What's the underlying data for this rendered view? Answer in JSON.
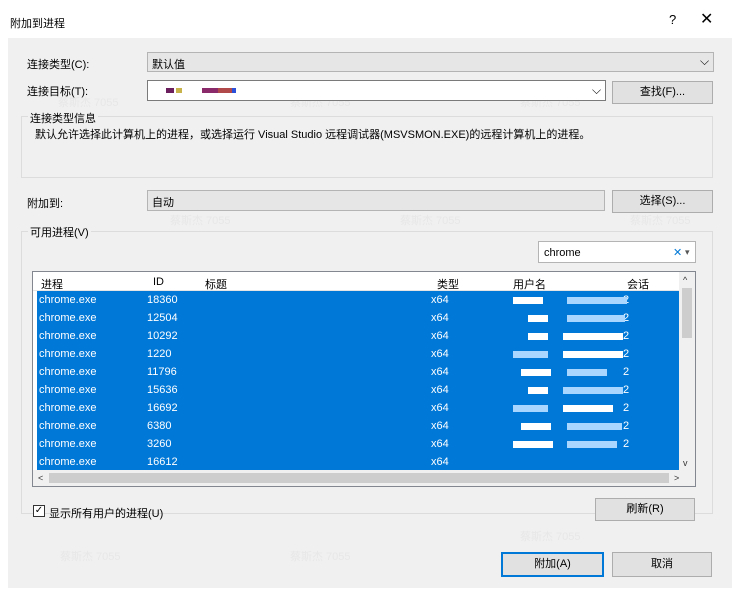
{
  "window": {
    "title": "附加到进程",
    "help_glyph": "?",
    "close_glyph": "✕"
  },
  "connection_type": {
    "label": "连接类型(C):",
    "value": "默认值",
    "arrow": "⌵"
  },
  "connection_target": {
    "label": "连接目标(T):",
    "arrow": "⌵",
    "find_button": "查找(F)..."
  },
  "info_group": {
    "title": "连接类型信息",
    "text": "默认允许选择此计算机上的进程，或选择运行 Visual Studio 远程调试器(MSVSMON.EXE)的远程计算机上的进程。"
  },
  "attach_to": {
    "label": "附加到:",
    "value": "自动",
    "select_button": "选择(S)..."
  },
  "process_group": {
    "title": "可用进程(V)"
  },
  "filter": {
    "value": "chrome",
    "clear_glyph": "✕",
    "dropdown_glyph": "▾"
  },
  "table": {
    "columns": [
      "进程",
      "ID",
      "标题",
      "类型",
      "用户名",
      "会话"
    ],
    "rows": [
      {
        "process": "chrome.exe",
        "id": "18360",
        "type": "x64",
        "session": "2"
      },
      {
        "process": "chrome.exe",
        "id": "12504",
        "type": "x64",
        "session": "2"
      },
      {
        "process": "chrome.exe",
        "id": "10292",
        "type": "x64",
        "session": "2"
      },
      {
        "process": "chrome.exe",
        "id": "1220",
        "type": "x64",
        "session": "2"
      },
      {
        "process": "chrome.exe",
        "id": "11796",
        "type": "x64",
        "session": "2"
      },
      {
        "process": "chrome.exe",
        "id": "15636",
        "type": "x64",
        "session": "2"
      },
      {
        "process": "chrome.exe",
        "id": "16692",
        "type": "x64",
        "session": "2"
      },
      {
        "process": "chrome.exe",
        "id": "6380",
        "type": "x64",
        "session": "2"
      },
      {
        "process": "chrome.exe",
        "id": "3260",
        "type": "x64",
        "session": "2"
      },
      {
        "process": "chrome.exe",
        "id": "16612",
        "type": "x64",
        "session": ""
      }
    ],
    "scroll_up": "^",
    "scroll_down": "v",
    "scroll_left": "<",
    "scroll_right": ">"
  },
  "show_all_users": {
    "label": "显示所有用户的进程(U)",
    "checked": true,
    "check_glyph": "✓"
  },
  "buttons": {
    "refresh": "刷新(R)",
    "attach": "附加(A)",
    "cancel": "取消"
  },
  "watermark": "蔡斯杰 7055",
  "colors": {
    "selection": "#0078d7",
    "dialog_bg": "#f0f0f0",
    "accent_border": "#0078d7"
  }
}
